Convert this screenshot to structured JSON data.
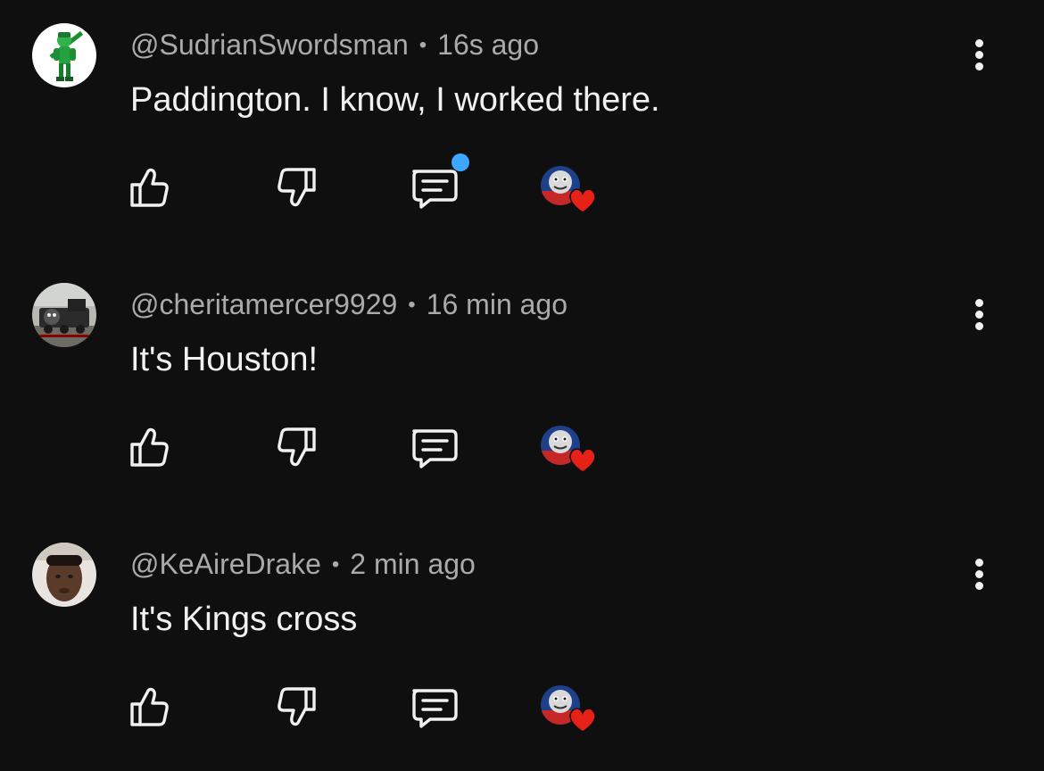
{
  "comments": [
    {
      "username": "@SudrianSwordsman",
      "separator": "•",
      "time": "16s ago",
      "text": "Paddington. I know, I worked there.",
      "has_reply_indicator": true
    },
    {
      "username": "@cheritamercer9929",
      "separator": "•",
      "time": "16 min ago",
      "text": "It's Houston!",
      "has_reply_indicator": false
    },
    {
      "username": "@KeAireDrake",
      "separator": "•",
      "time": "2 min ago",
      "text": "It's Kings cross",
      "has_reply_indicator": false
    }
  ],
  "icons": {
    "like": "thumbs-up-icon",
    "dislike": "thumbs-down-icon",
    "reply": "reply-icon",
    "more": "more-vertical-icon",
    "creator_heart": "heart-icon"
  },
  "colors": {
    "background": "#0f0f0f",
    "text": "#f1f1f1",
    "meta": "#aaaaaa",
    "notification_dot": "#3ea6ff",
    "heart": "#e62117"
  }
}
